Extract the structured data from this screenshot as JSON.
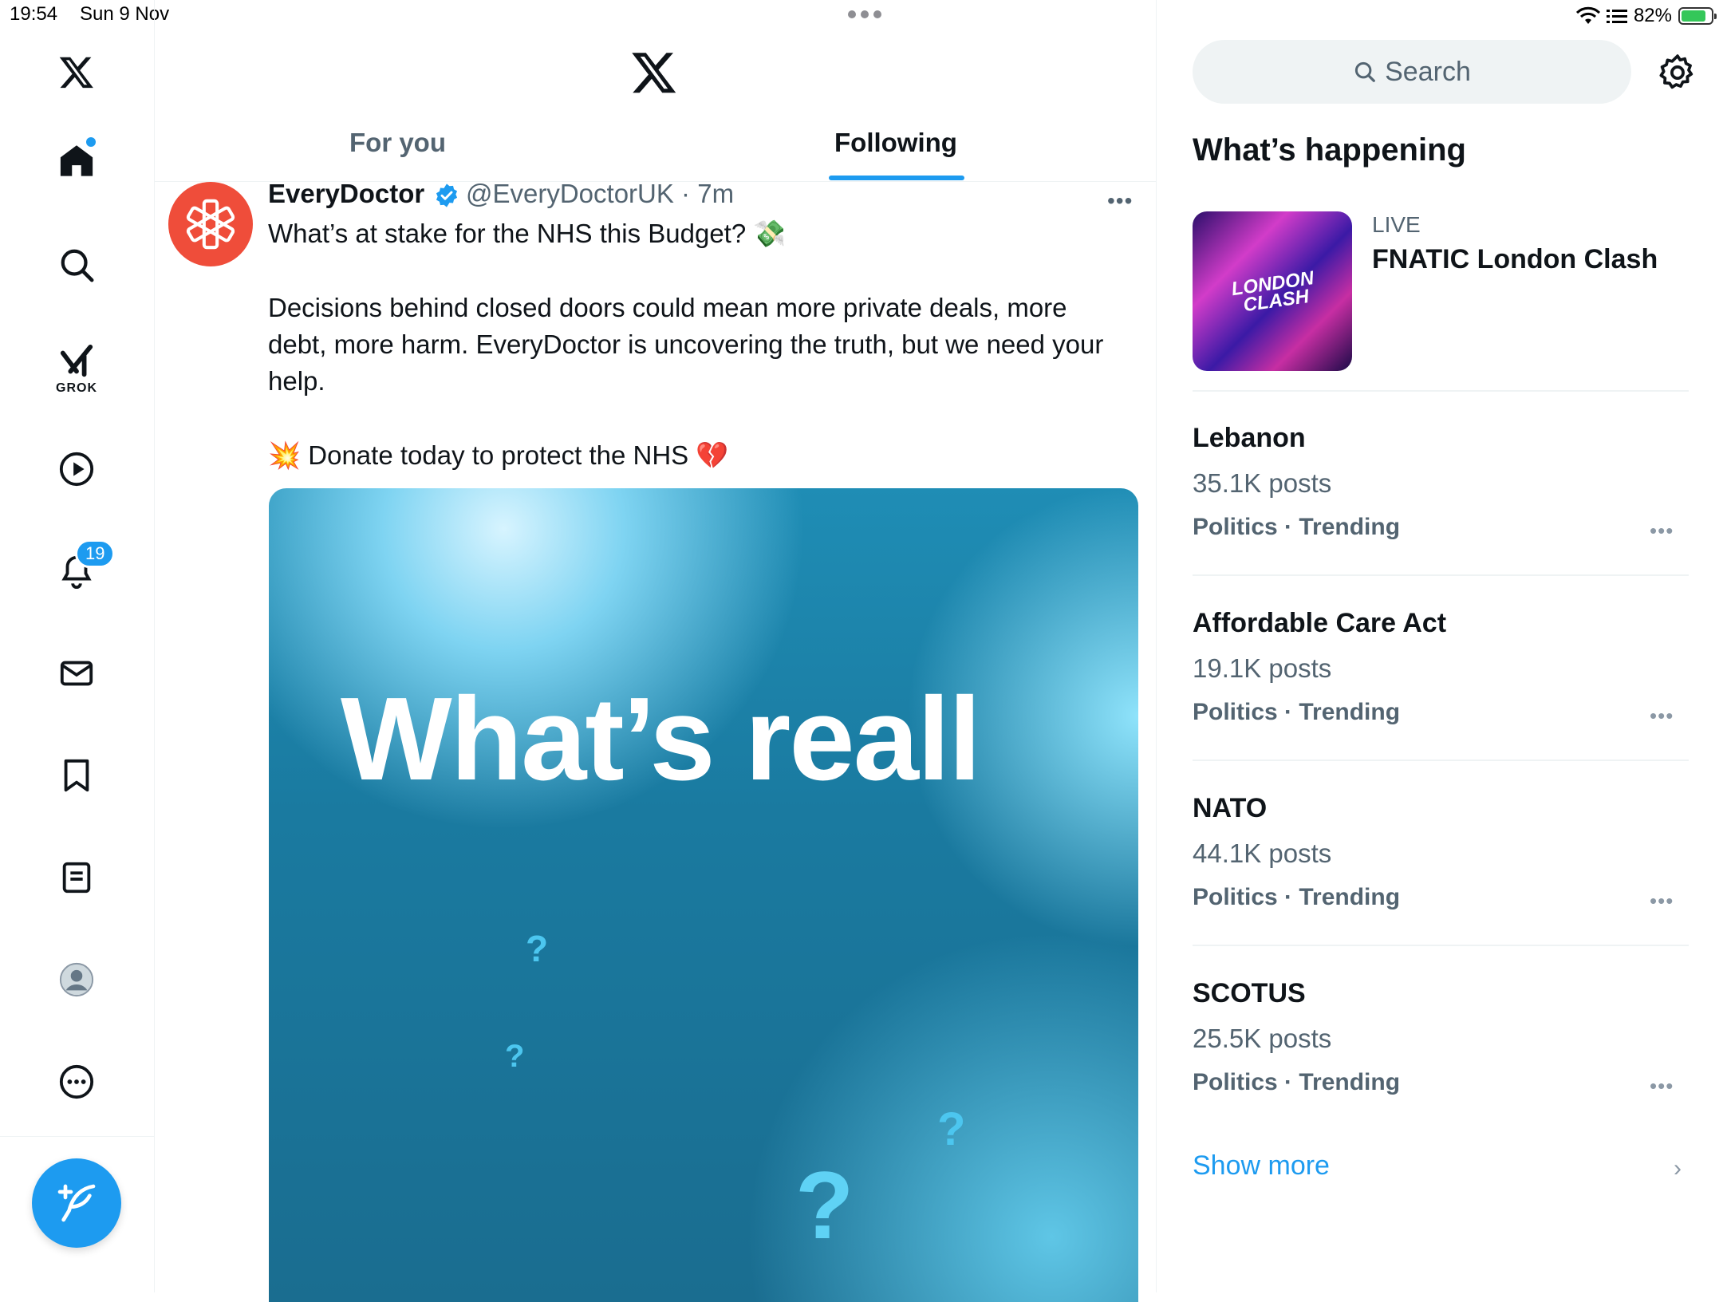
{
  "status_bar": {
    "time": "19:54",
    "date": "Sun 9 Nov",
    "battery": "82%",
    "battery_level": 0.82
  },
  "sidebar": {
    "items": [
      {
        "name": "x-logo"
      },
      {
        "name": "home",
        "icon": "home-icon"
      },
      {
        "name": "explore",
        "icon": "search-icon"
      },
      {
        "name": "grok",
        "icon": "grok-icon",
        "label": "GROK"
      },
      {
        "name": "video",
        "icon": "play-icon"
      },
      {
        "name": "notifications",
        "icon": "bell-icon",
        "badge": "19"
      },
      {
        "name": "messages",
        "icon": "mail-icon"
      },
      {
        "name": "bookmarks",
        "icon": "bookmark-icon"
      },
      {
        "name": "lists",
        "icon": "list-icon"
      },
      {
        "name": "profile",
        "icon": "avatar-icon"
      },
      {
        "name": "more",
        "icon": "more-circle-icon"
      }
    ],
    "compose_icon": "compose-icon"
  },
  "main": {
    "tabs": [
      {
        "label": "For you",
        "active": false
      },
      {
        "label": "Following",
        "active": true
      }
    ],
    "tweet": {
      "name": "EveryDoctor",
      "handle": "@EveryDoctorUK · 7m",
      "line1": "What’s at stake for the NHS this Budget? 💸",
      "line2": "Decisions behind closed doors could mean more private deals, more",
      "line3": "debt, more harm. EveryDoctor is uncovering the truth, but we need your",
      "line4": "help.",
      "line5": "💥 Donate today to protect the NHS 💔",
      "media_text": "What’s reall"
    }
  },
  "right": {
    "search_placeholder": "Search",
    "heading": "What’s happening",
    "live": {
      "label": "LIVE",
      "title": "FNATIC London Clash",
      "thumb_text_1": "LONDON",
      "thumb_text_2": "CLASH"
    },
    "trends": [
      {
        "name": "Lebanon",
        "count": "35.1K posts",
        "category": "Politics · Trending"
      },
      {
        "name": "Affordable Care Act",
        "count": "19.1K posts",
        "category": "Politics · Trending"
      },
      {
        "name": "NATO",
        "count": "44.1K posts",
        "category": "Politics · Trending"
      },
      {
        "name": "SCOTUS",
        "count": "25.5K posts",
        "category": "Politics · Trending"
      }
    ],
    "show_more": "Show more"
  },
  "colors": {
    "accent": "#1d9bf0",
    "avatar_bg": "#ef4d3a",
    "secondary_text": "#536471"
  }
}
